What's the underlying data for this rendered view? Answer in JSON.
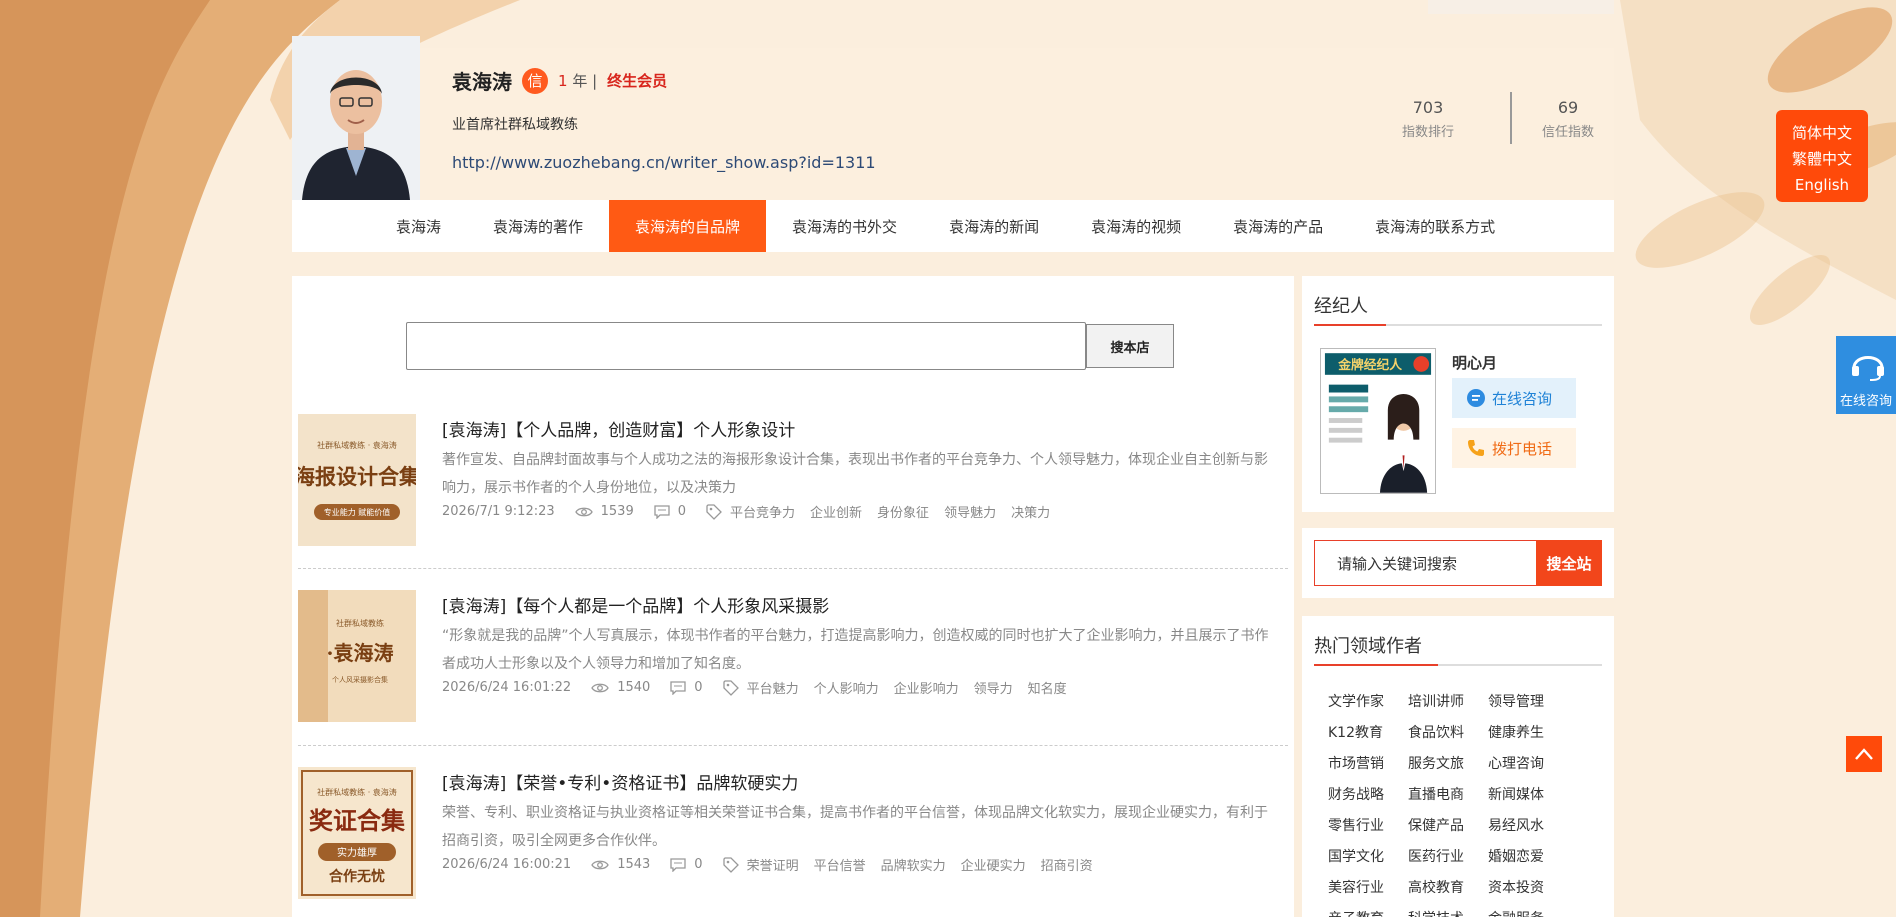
{
  "profile": {
    "name": "袁海涛",
    "badge": "信",
    "years_num": "1",
    "years_unit": "年",
    "member": "终生会员",
    "title": "业首席社群私域教练",
    "url": "http://www.zuozhebang.cn/writer_show.asp?id=1311",
    "stats": [
      {
        "value": "703",
        "label": "指数排行"
      },
      {
        "value": "69",
        "label": "信任指数"
      }
    ]
  },
  "nav": {
    "items": [
      "袁海涛",
      "袁海涛的著作",
      "袁海涛的自品牌",
      "袁海涛的书外交",
      "袁海涛的新闻",
      "袁海涛的视频",
      "袁海涛的产品",
      "袁海涛的联系方式"
    ],
    "active_index": 2
  },
  "search": {
    "button": "搜本店"
  },
  "articles": [
    {
      "title": "[袁海涛]【个人品牌，创造财富】个人形象设计",
      "desc": "著作宣发、自品牌封面故事与个人成功之法的海报形象设计合集，表现出书作者的平台竞争力、个人领导魅力，体现企业自主创新与影响力，展示书作者的个人身份地位，以及决策力",
      "date": "2026/7/1 9:12:23",
      "views": "1539",
      "comments": "0",
      "tags": [
        "平台竞争力",
        "企业创新",
        "身份象征",
        "领导魅力",
        "决策力"
      ],
      "cover": {
        "top": "社群私域教练 · 袁海涛",
        "big": "海报设计合集",
        "ribbon": "专业能力 赋能价值"
      }
    },
    {
      "title": "[袁海涛]【每个人都是一个品牌】个人形象风采摄影",
      "desc": "“形象就是我的品牌”个人写真展示，体现书作者的平台魅力，打造提高影响力，创造权威的同时也扩大了企业影响力，并且展示了书作者成功人士形象以及个人领导力和增加了知名度。",
      "date": "2026/6/24 16:01:22",
      "views": "1540",
      "comments": "0",
      "tags": [
        "平台魅力",
        "个人影响力",
        "企业影响力",
        "领导力",
        "知名度"
      ],
      "cover": {
        "top": "社群私域教练",
        "big": "·袁海涛",
        "ribbon": "个人风采摄影合集"
      }
    },
    {
      "title": "[袁海涛]【荣誉•专利•资格证书】品牌软硬实力",
      "desc": "荣誉、专利、职业资格证与执业资格证等相关荣誉证书合集，提高书作者的平台信誉，体现品牌文化软实力，展现企业硬实力，有利于招商引资，吸引全网更多合作伙伴。",
      "date": "2026/6/24 16:00:21",
      "views": "1543",
      "comments": "0",
      "tags": [
        "荣誉证明",
        "平台信誉",
        "品牌软实力",
        "企业硬实力",
        "招商引资"
      ],
      "cover": {
        "top": "社群私域教练 · 袁海涛",
        "big": "奖证合集",
        "ribbon": "实力雄厚",
        "bottom": "合作无忧"
      }
    }
  ],
  "agent": {
    "heading": "经纪人",
    "name": "明心月",
    "consult": "在线咨询",
    "call": "拨打电话",
    "card_title": "金牌经纪人"
  },
  "site_search": {
    "value": "请输入关键词搜索",
    "button": "搜全站"
  },
  "hot": {
    "heading": "热门领域作者",
    "tags": [
      "文学作家",
      "培训讲师",
      "领导管理",
      "K12教育",
      "食品饮料",
      "健康养生",
      "市场营销",
      "服务文旅",
      "心理咨询",
      "财务战略",
      "直播电商",
      "新闻媒体",
      "零售行业",
      "保健产品",
      "易经风水",
      "国学文化",
      "医药行业",
      "婚姻恋爱",
      "美容行业",
      "高校教育",
      "资本投资",
      "亲子教育",
      "科学技术",
      "金融服务"
    ]
  },
  "floaters": {
    "lang": [
      "简体中文",
      "繁體中文",
      "English"
    ],
    "online": "在线咨询"
  },
  "colors": {
    "accent": "#ff5a14",
    "link": "#2d4a76",
    "badge_red": "#d8251c"
  }
}
